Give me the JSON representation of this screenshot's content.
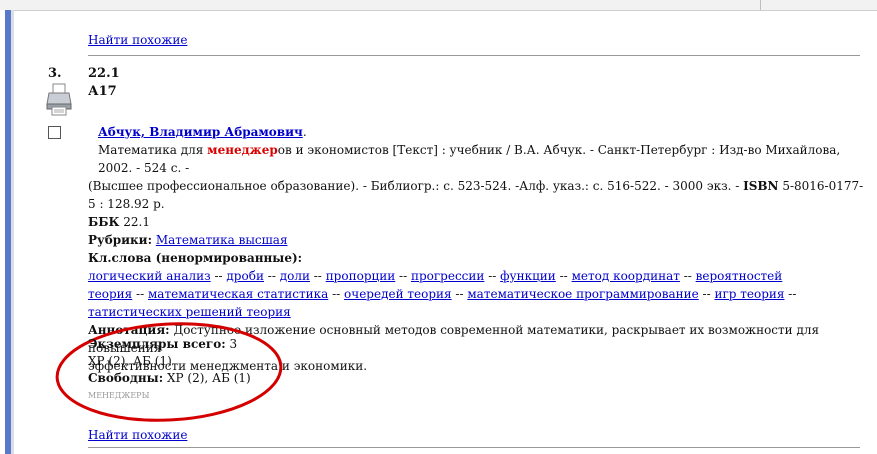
{
  "find_similar_top": "Найти похожие",
  "record": {
    "number": "3.",
    "code1": "22.1",
    "code2": "А17",
    "author": "Абчук, Владимир Абрамович",
    "author_suffix": ".",
    "desc_prefix": "Математика для ",
    "desc_highlight": "менеджер",
    "desc_rest": "ов и экономистов [Текст] : учебник / В.А. Абчук. - Санкт-Петербург : Изд-во Михайлова, 2002. - 524 с. -",
    "desc_line2_a": "(Высшее профессиональное образование). - Библиогр.: с. 523-524. -Алф. указ.: с. 516-522. - 3000 экз. - ",
    "desc_isbn_label": "ISBN",
    "desc_line2_b": " 5-8016-0177-5 : 128.92 р.",
    "bbk_label": "ББК",
    "bbk_value": " 22.1",
    "rubrics_label": "Рубрики:",
    "rubric_link": "Математика высшая",
    "keywords_label": "Кл.слова (ненормированные):",
    "keywords": [
      "логический анализ",
      "дроби",
      "доли",
      "пропорции",
      "прогрессии",
      "функции",
      "метод координат",
      "вероятностей теория",
      "математическая статистика",
      "очередей теория",
      "математическое программирование",
      "игр теория",
      "татистических решений теория"
    ],
    "keyword_sep": " -- ",
    "annotation_label": "Аннотация:",
    "annotation_line1": " Доступное изложение основный методов современной математики, раскрывает их возможности для повышения",
    "annotation_line2": "эффективности менеджмента и экономики.",
    "copies_label": "Экземпляры всего:",
    "copies_value": " 3",
    "copies_locations": "ХР (2), АБ (1)",
    "free_label": "Свободны:",
    "free_value": " ХР (2), АБ (1)",
    "small_tag": "МЕНЕДЖЕРЫ"
  },
  "find_similar_bottom": "Найти похожие",
  "colors": {
    "link": "#0000cc",
    "highlight": "#d80000",
    "oval": "#d40000",
    "left_bar": "#5a78c8"
  },
  "icons": [
    "printer-icon",
    "checkbox"
  ]
}
